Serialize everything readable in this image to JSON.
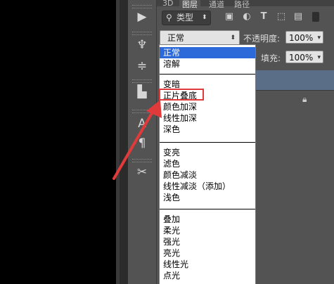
{
  "tabs": [
    "3D",
    "图层",
    "通道",
    "路径"
  ],
  "active_tab": "图层",
  "filter": {
    "label": "类型",
    "icon": "search-icon"
  },
  "filter_icons": [
    "image-filter-icon",
    "adjustment-filter-icon",
    "type-filter-icon",
    "shape-filter-icon",
    "smart-object-filter-icon"
  ],
  "blend": {
    "value": "正常"
  },
  "opacity": {
    "label": "不透明度:",
    "value": "100%"
  },
  "fill": {
    "label": "填充:",
    "value": "100%"
  },
  "menu_groups": [
    [
      "正常",
      "溶解"
    ],
    [
      "变暗",
      "正片叠底",
      "颜色加深",
      "线性加深",
      "深色"
    ],
    [
      "变亮",
      "滤色",
      "颜色减淡",
      "线性减淡（添加）",
      "浅色"
    ],
    [
      "叠加",
      "柔光",
      "强光",
      "亮光",
      "线性光",
      "点光"
    ]
  ],
  "selected_option": "正常",
  "highlighted_option": "正片叠底",
  "colors": {
    "selection": "#2b6ad8",
    "highlight_box": "#e03a3a",
    "arrow": "#e03a3a",
    "panel": "#535353"
  }
}
